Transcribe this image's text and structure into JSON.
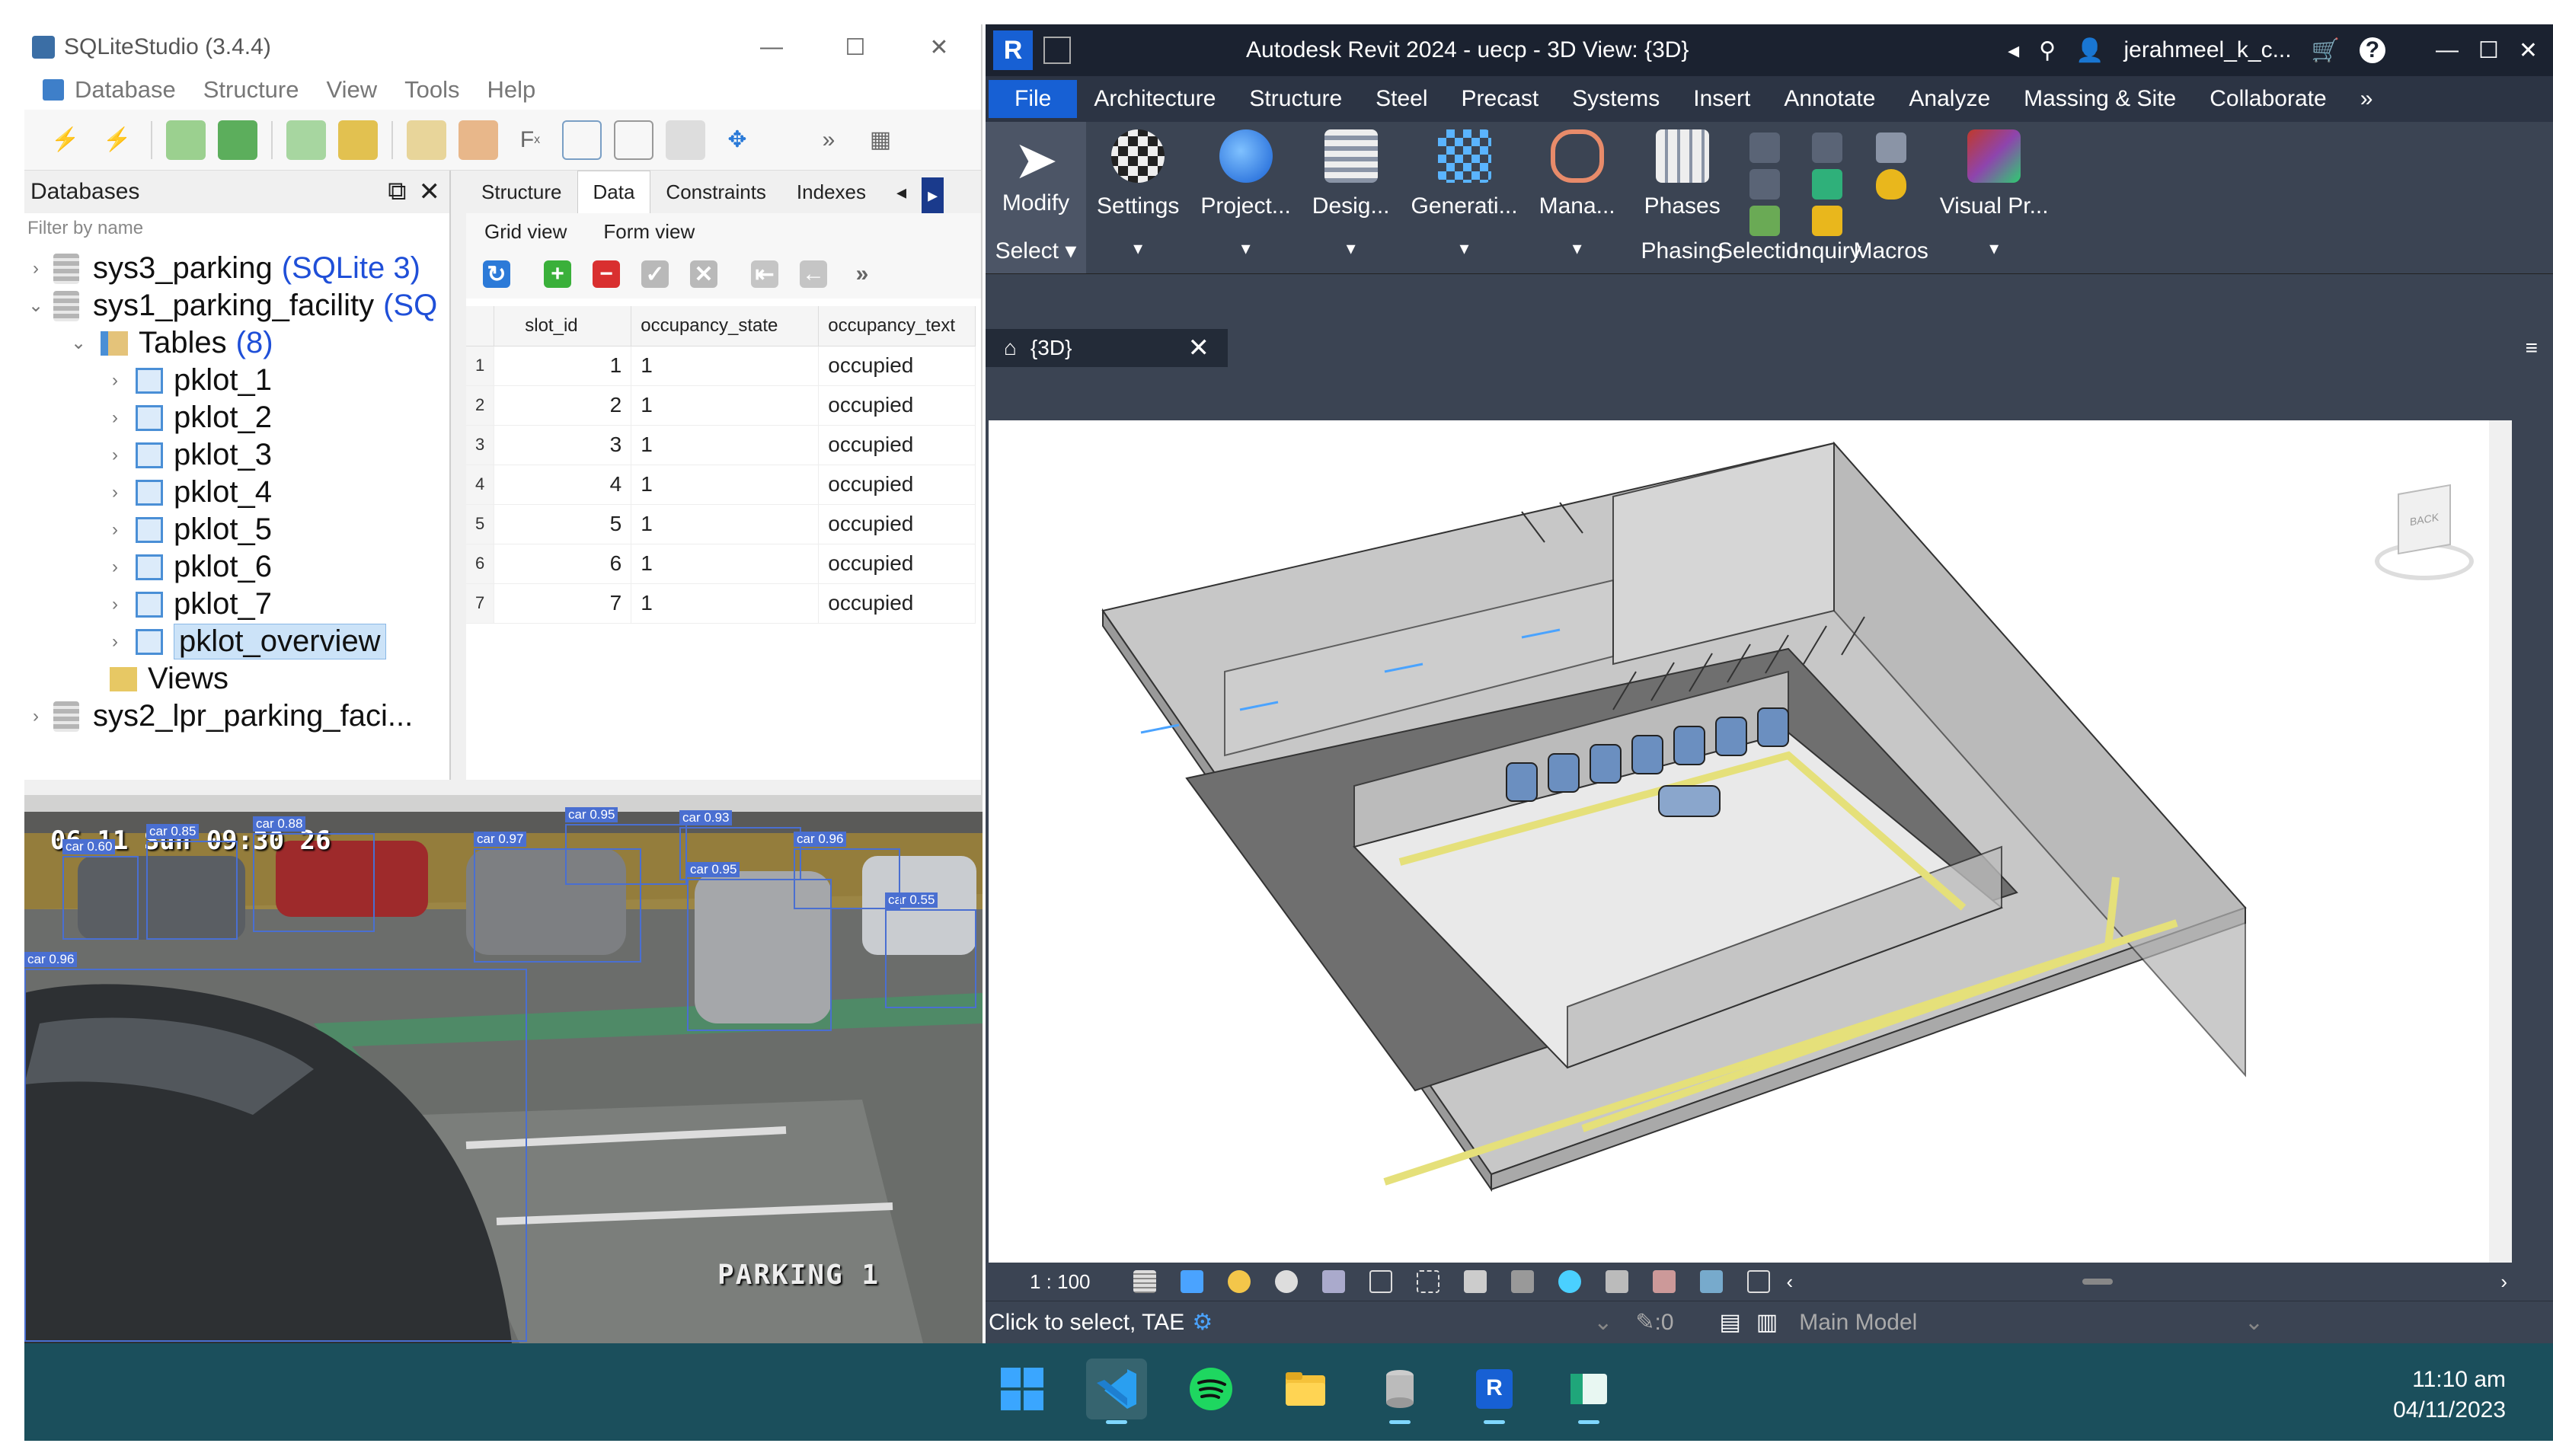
{
  "sqlite": {
    "title": "SQLiteStudio (3.4.4)",
    "window_controls": [
      "—",
      "☐",
      "✕"
    ],
    "menu": [
      "Database",
      "Structure",
      "View",
      "Tools",
      "Help"
    ],
    "databases_panel_title": "Databases",
    "filter_placeholder": "Filter by name",
    "tree": {
      "db_sys3": "sys3_parking",
      "db_sys3_type": "(SQLite 3)",
      "db_sys1": "sys1_parking_facility",
      "db_sys1_type": "(SQ",
      "tables_label": "Tables",
      "tables_count": "(8)",
      "tables": [
        "pklot_1",
        "pklot_2",
        "pklot_3",
        "pklot_4",
        "pklot_5",
        "pklot_6",
        "pklot_7",
        "pklot_overview"
      ],
      "views_label": "Views",
      "db_sys2": "sys2_lpr_parking_faci..."
    },
    "tabs": [
      "Structure",
      "Data",
      "Constraints",
      "Indexes"
    ],
    "active_tab": "Data",
    "subtabs": [
      "Grid view",
      "Form view"
    ],
    "grid": {
      "columns": [
        "slot_id",
        "occupancy_state",
        "occupancy_text"
      ],
      "rows": [
        [
          "1",
          "1",
          "1",
          "occupied"
        ],
        [
          "2",
          "2",
          "1",
          "occupied"
        ],
        [
          "3",
          "3",
          "1",
          "occupied"
        ],
        [
          "4",
          "4",
          "1",
          "occupied"
        ],
        [
          "5",
          "5",
          "1",
          "occupied"
        ],
        [
          "6",
          "6",
          "1",
          "occupied"
        ],
        [
          "7",
          "7",
          "1",
          "occupied"
        ]
      ]
    }
  },
  "camera": {
    "timestamp": "06-11 Sun 09:30 26",
    "label": "PARKING 1",
    "detections": [
      "car 0.60",
      "car 0.85",
      "car 0.96",
      "car 0.88",
      "car 0.97",
      "car 0.95",
      "car 0.93",
      "car 0.95",
      "car 0.55",
      "car 0.96"
    ]
  },
  "revit": {
    "logo": "R",
    "title": "Autodesk Revit 2024 - uecp - 3D View: {3D}",
    "user": "jerahmeel_k_c...",
    "tabs": [
      "File",
      "Architecture",
      "Structure",
      "Steel",
      "Precast",
      "Systems",
      "Insert",
      "Annotate",
      "Analyze",
      "Massing & Site",
      "Collaborate"
    ],
    "ribbon": {
      "modify": "Modify",
      "select": "Select",
      "settings": "Settings",
      "project": "Project...",
      "design": "Desig...",
      "generation": "Generati...",
      "manage": "Mana...",
      "phases": "Phases",
      "phasing": "Phasing",
      "selection": "Selection",
      "inquiry": "Inquiry",
      "macros": "Macros",
      "visual": "Visual Pr..."
    },
    "view_tab": "{3D}",
    "viewcube_label": "BACK",
    "scale": "1 : 100",
    "status_text": "Click to select, TAE",
    "status_zero": ":0",
    "model": "Main Model"
  },
  "taskbar": {
    "time": "11:10 am",
    "date": "04/11/2023"
  },
  "colors": {
    "revit_dark": "#3b4453",
    "revit_title": "#1b2230",
    "revit_blue": "#1760d4",
    "taskbar": "#1b4f5c",
    "tree_blue": "#1f4fd8",
    "detection_box": "#4a6fd1"
  }
}
